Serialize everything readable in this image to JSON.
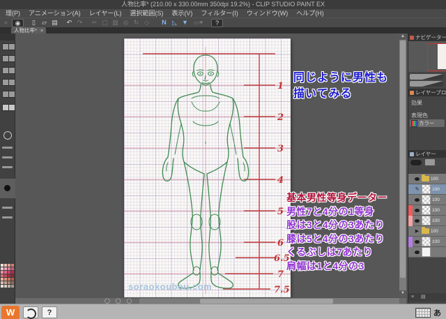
{
  "title_bar": {
    "title": "人物比率* (210.00 x 330.00mm 350dpi 19.2%) - CLIP STUDIO PAINT EX"
  },
  "menu": {
    "items": [
      "理(P)",
      "アニメーション(A)",
      "レイヤー(L)",
      "選択範囲(S)",
      "表示(V)",
      "フィルター(I)",
      "ウィンドウ(W)",
      "ヘルプ(H)"
    ]
  },
  "toolbar": {
    "icons": [
      {
        "name": "panel-collapse-icon",
        "glyph": "«"
      },
      {
        "name": "clip-studio-logo-icon",
        "glyph": "◉"
      },
      {
        "name": "new-file-icon",
        "glyph": "▯"
      },
      {
        "name": "open-file-icon",
        "glyph": "▱"
      },
      {
        "name": "save-icon",
        "glyph": "▤"
      },
      {
        "name": "undo-icon",
        "glyph": "↶"
      },
      {
        "name": "redo-icon",
        "glyph": "↷"
      },
      {
        "name": "cut-icon",
        "glyph": "✂"
      },
      {
        "name": "copy-icon",
        "glyph": "▢"
      },
      {
        "name": "paste-icon",
        "glyph": "▥"
      },
      {
        "name": "zoom-icon",
        "glyph": "◎"
      },
      {
        "name": "rotate-icon",
        "glyph": "↻"
      },
      {
        "name": "transform-icon",
        "glyph": "◇"
      },
      {
        "name": "snap-ruler-icon",
        "glyph": "N"
      },
      {
        "name": "snap-special-ruler-icon",
        "glyph": "◺"
      },
      {
        "name": "snap-grid-icon",
        "glyph": "▼"
      },
      {
        "name": "ruler-menu-icon",
        "glyph": "▭▾"
      },
      {
        "name": "help-icon",
        "glyph": "?"
      }
    ]
  },
  "doc_tab": {
    "label": "人物比率*",
    "close": "×"
  },
  "canvas": {
    "ruler_labels": [
      "1",
      "2",
      "3",
      "4",
      "5",
      "6",
      "6.5",
      "7",
      "7.5"
    ],
    "watermark": "soraokoubou.com",
    "figure_color": "#3e8b52",
    "guide_color": "#c23b3b"
  },
  "annotations": {
    "blue_note": {
      "color": "#1a18cf",
      "lines": [
        "同じように男性も",
        "描いてみる"
      ]
    },
    "data_note": {
      "title": "基本男性等身データー",
      "title_color": "#ae1038",
      "body_color": "#9232d2",
      "lines": [
        "男性7と4分の1等身",
        "股は3と4分の3あたり",
        "膝は5と4分の3あたり",
        "くるぶしは7あたり",
        "肩幅は1と4分の3"
      ]
    }
  },
  "right_panel": {
    "navigator": {
      "tab": "ナビゲーター"
    },
    "layer_property": {
      "tab": "レイヤープロパティ",
      "effect_label": "効果",
      "expression_label": "表現色",
      "expression_value": "カラー"
    },
    "layers": {
      "tab": "レイヤー",
      "rows": [
        {
          "opacity": "100",
          "label_color": ""
        },
        {
          "opacity": "100",
          "label_color": ""
        },
        {
          "opacity": "100",
          "label_color": ""
        },
        {
          "opacity": "100",
          "label_color": "#f25b5b"
        },
        {
          "opacity": "100",
          "label_color": "#f9a0a0"
        },
        {
          "opacity": "100",
          "label_color": ""
        },
        {
          "opacity": "100",
          "label_color": "#b77be8"
        },
        {
          "opacity": "",
          "label_color": ""
        }
      ]
    }
  },
  "left_panel": {
    "palette": [
      "#f6e3da",
      "#efc3b4",
      "#e3a092",
      "#d3806e",
      "#f3cdd6",
      "#eaa6ba",
      "#df7f9d",
      "#cf5c80",
      "#ef93a7",
      "#e56787",
      "#d93b66",
      "#c22249",
      "#d96a79",
      "#c24a5a",
      "#a52f3f",
      "#8b2433",
      "#edb39e",
      "#e0937e",
      "#cf7360",
      "#bb5546",
      "#d9c0b5",
      "#c3a296",
      "#aa8376",
      "#93685c",
      "#eae2d8",
      "#d4ccc2",
      "#bcb4aa",
      "#a49c92"
    ]
  },
  "taskbar": {
    "app_w": "W",
    "help": "?",
    "ime_mode": "あ"
  }
}
